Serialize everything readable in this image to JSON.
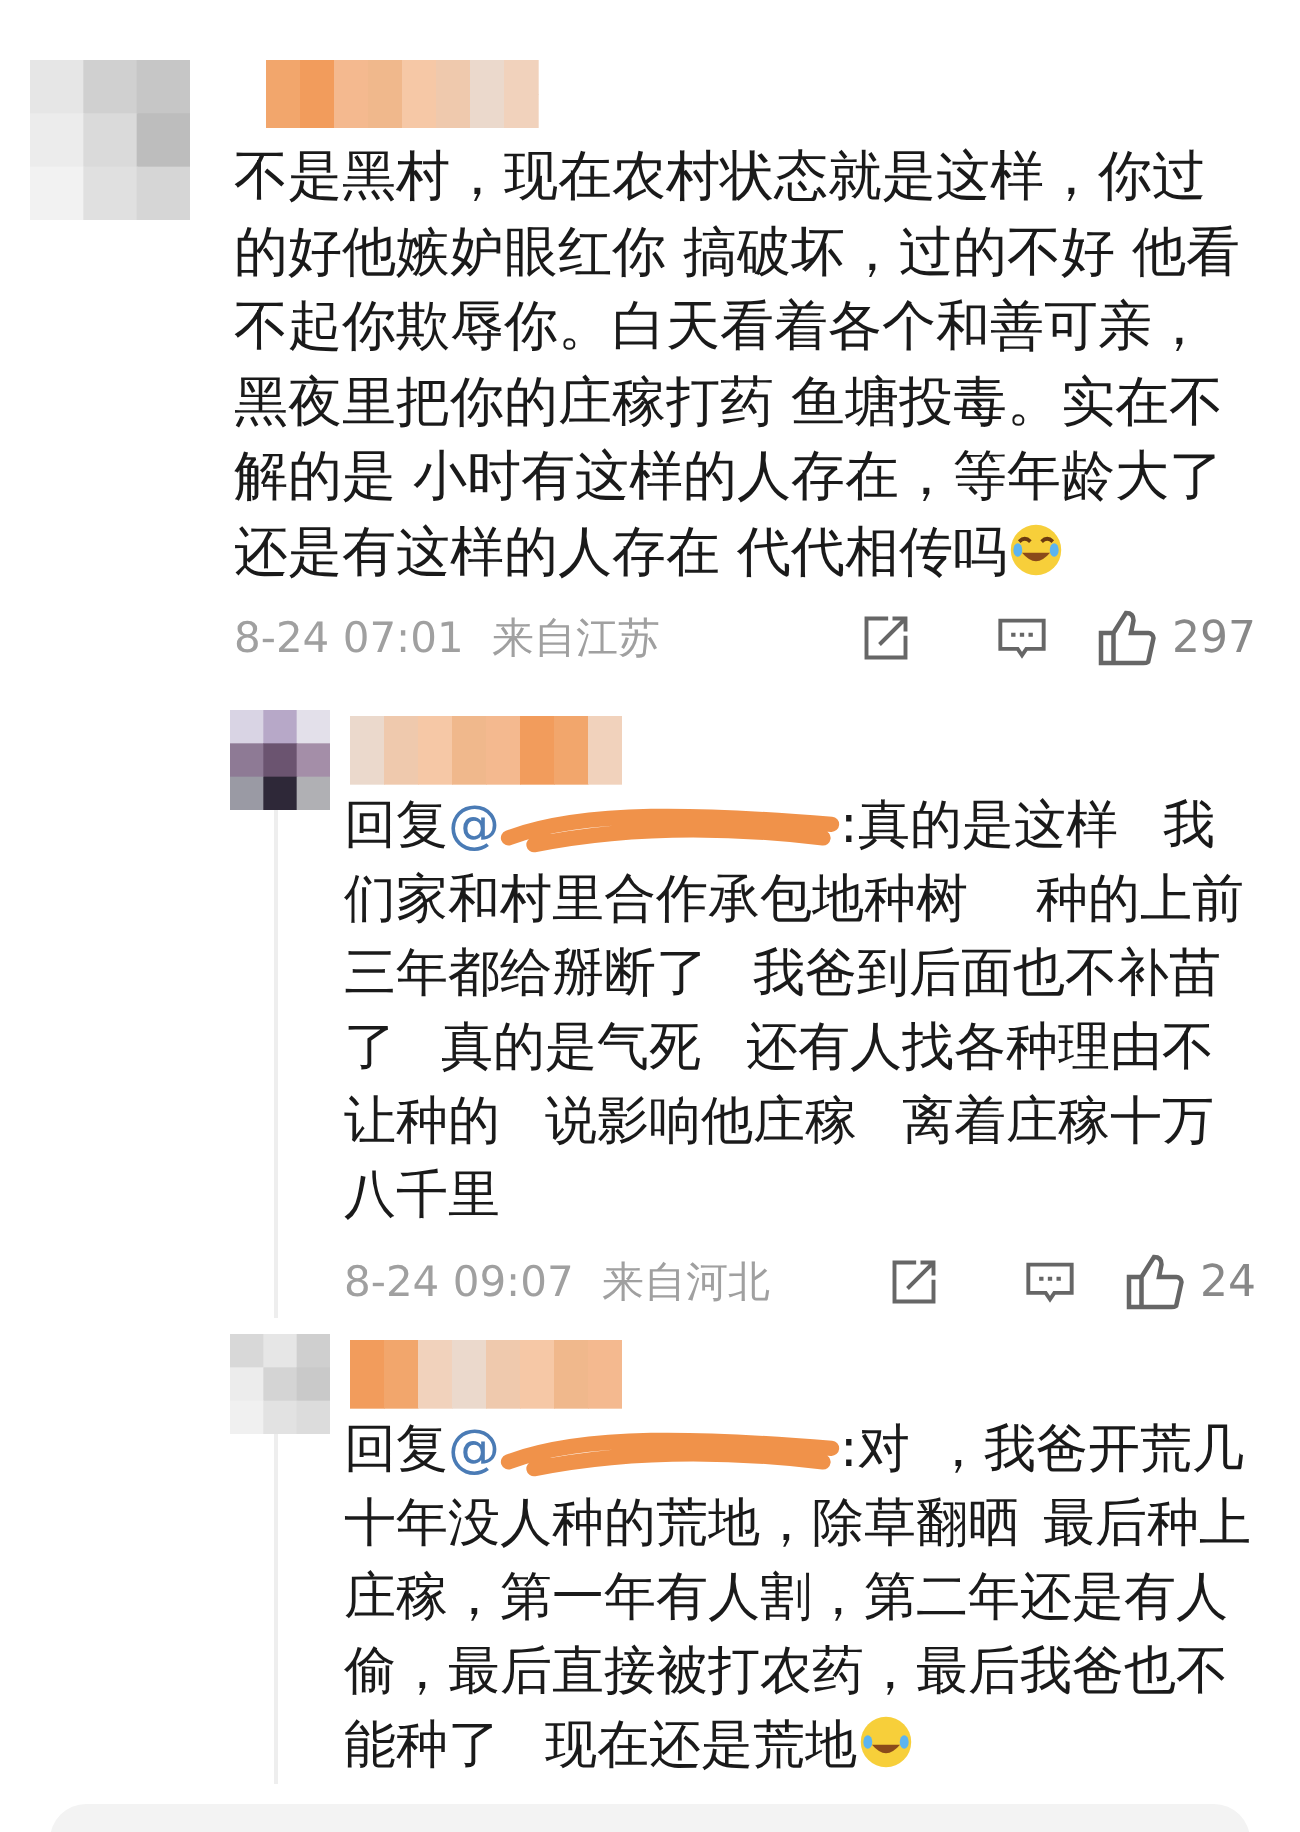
{
  "comments": [
    {
      "text": "不是黑村，现在农村状态就是这样，你过的好他嫉妒眼红你 搞破坏，过的不好 他看不起你欺辱你。白天看着各个和善可亲，黑夜里把你的庄稼打药 鱼塘投毒。实在不解的是 小时有这样的人存在，等年龄大了还是有这样的人存在 代代相传吗",
      "emoji": true,
      "time": "8-24 07:01",
      "location": "来自江苏",
      "likes": "297",
      "replies": [
        {
          "prefix": "回复",
          "mention": "@",
          "text": ":真的是这样  我们家和村里合作承包地种树   种的上前三年都给掰断了  我爸到后面也不补苗了  真的是气死  还有人找各种理由不让种的  说影响他庄稼  离着庄稼十万八千里",
          "emoji": false,
          "time": "8-24 09:07",
          "location": "来自河北",
          "likes": "24"
        },
        {
          "prefix": "回复",
          "mention": "@",
          "text": ":对 ，我爸开荒几十年没人种的荒地，除草翻晒 最后种上庄稼，第一年有人割，第二年还是有人偷，最后直接被打农药，最后我爸也不能种了  现在还是荒地",
          "emoji": true
        }
      ]
    }
  ]
}
